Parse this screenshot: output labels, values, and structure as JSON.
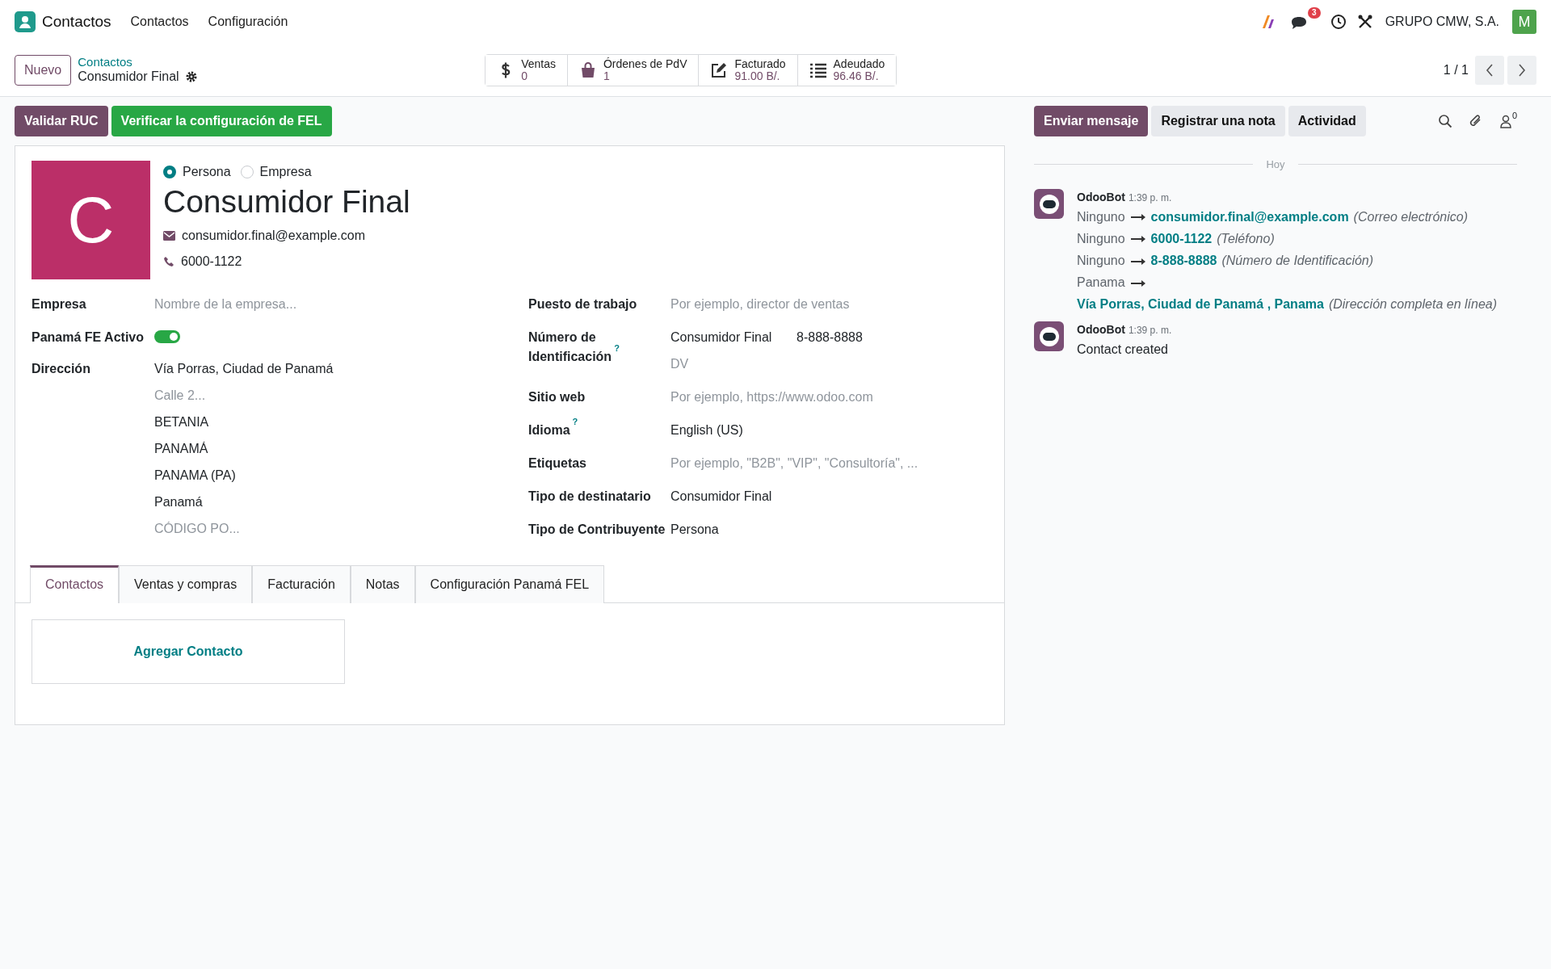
{
  "app": {
    "name": "Contactos"
  },
  "menu": [
    "Contactos",
    "Configuración"
  ],
  "systray": {
    "chat_count": "3",
    "company": "GRUPO CMW, S.A.",
    "avatar_letter": "M"
  },
  "breadcrumb": {
    "new_button": "Nuevo",
    "parent": "Contactos",
    "current": "Consumidor Final"
  },
  "smart_buttons": [
    {
      "kind": "dollar",
      "label": "Ventas",
      "value": "0"
    },
    {
      "kind": "bag",
      "label": "Órdenes de PdV",
      "value": "1"
    },
    {
      "kind": "edit",
      "label": "Facturado",
      "value": "91.00 B/."
    },
    {
      "kind": "list",
      "label": "Adeudado",
      "value": "96.46 B/."
    }
  ],
  "pager": {
    "value": "1 / 1"
  },
  "action_buttons": [
    {
      "kind": "primary",
      "label": "Validar RUC"
    },
    {
      "kind": "success",
      "label": "Verificar la configuración de FEL"
    }
  ],
  "form": {
    "avatar_letter": "C",
    "company_type": [
      {
        "label": "Persona",
        "selected": true
      },
      {
        "label": "Empresa",
        "selected": false
      }
    ],
    "name": "Consumidor Final",
    "email": "consumidor.final@example.com",
    "phone": "6000-1122",
    "left_fields": [
      {
        "kind": "input",
        "label": "Empresa",
        "rows": [
          [
            {
              "placeholder": "Nombre de la empresa..."
            }
          ]
        ]
      },
      {
        "kind": "toggle",
        "label": "Panamá FE Activo",
        "on": true
      },
      {
        "kind": "input",
        "label": "Dirección",
        "rows": [
          [
            {
              "value": "Vía Porras, Ciudad de Panamá"
            }
          ],
          [
            {
              "placeholder": "Calle 2..."
            }
          ],
          [
            {
              "value": "BETANIA"
            }
          ],
          [
            {
              "value": "PANAMÁ"
            }
          ],
          [
            {
              "value": "PANAMA (PA)"
            }
          ],
          [
            {
              "value": "Panamá"
            }
          ],
          [
            {
              "placeholder": "CÓDIGO PO..."
            }
          ]
        ]
      }
    ],
    "right_fields": [
      {
        "kind": "input",
        "label": "Puesto de trabajo",
        "rows": [
          [
            {
              "placeholder": "Por ejemplo, director de ventas"
            }
          ]
        ]
      },
      {
        "kind": "input",
        "label": "Número de Identificación",
        "help": "?",
        "rows": [
          [
            {
              "value": "Consumidor Final"
            },
            {
              "value": "8-888-8888"
            }
          ],
          [
            {
              "placeholder": "DV"
            }
          ]
        ]
      },
      {
        "kind": "input",
        "label": "Sitio web",
        "rows": [
          [
            {
              "placeholder": "Por ejemplo, https://www.odoo.com"
            }
          ]
        ]
      },
      {
        "kind": "input",
        "label": "Idioma",
        "help": "?",
        "rows": [
          [
            {
              "value": "English (US)"
            }
          ]
        ]
      },
      {
        "kind": "input",
        "label": "Etiquetas",
        "rows": [
          [
            {
              "placeholder": "Por ejemplo, \"B2B\", \"VIP\", \"Consultoría\", ..."
            }
          ]
        ]
      },
      {
        "kind": "input",
        "label": "Tipo de destinatario",
        "rows": [
          [
            {
              "value": "Consumidor Final"
            }
          ]
        ]
      },
      {
        "kind": "input",
        "label": "Tipo de Contribuyente",
        "rows": [
          [
            {
              "value": "Persona"
            }
          ]
        ]
      }
    ],
    "tabs": [
      {
        "label": "Contactos",
        "selected": true
      },
      {
        "label": "Ventas y compras",
        "selected": false
      },
      {
        "label": "Facturación",
        "selected": false
      },
      {
        "label": "Notas",
        "selected": false
      },
      {
        "label": "Configuración Panamá FEL",
        "selected": false
      }
    ],
    "add_contact": "Agregar Contacto"
  },
  "chatter": {
    "buttons": [
      {
        "kind": "primary",
        "label": "Enviar mensaje"
      },
      {
        "kind": "secondary",
        "label": "Registrar una nota"
      },
      {
        "kind": "secondary",
        "label": "Actividad"
      }
    ],
    "follower_count": "0",
    "date_separator": "Hoy",
    "messages": [
      {
        "kind": "tracking",
        "author": "OdooBot",
        "time": "1:39 p. m.",
        "changes": [
          {
            "old": "Ninguno",
            "new": "consumidor.final@example.com",
            "field": "(Correo electrónico)"
          },
          {
            "old": "Ninguno",
            "new": "6000-1122",
            "field": "(Teléfono)"
          },
          {
            "old": "Ninguno",
            "new": "8-888-8888",
            "field": "(Número de Identificación)"
          },
          {
            "old": "Panama",
            "new": "Vía Porras, Ciudad de Panamá , Panama",
            "field": "(Dirección completa en línea)"
          }
        ]
      },
      {
        "kind": "text",
        "author": "OdooBot",
        "time": "1:39 p. m.",
        "body": "Contact created"
      }
    ]
  }
}
